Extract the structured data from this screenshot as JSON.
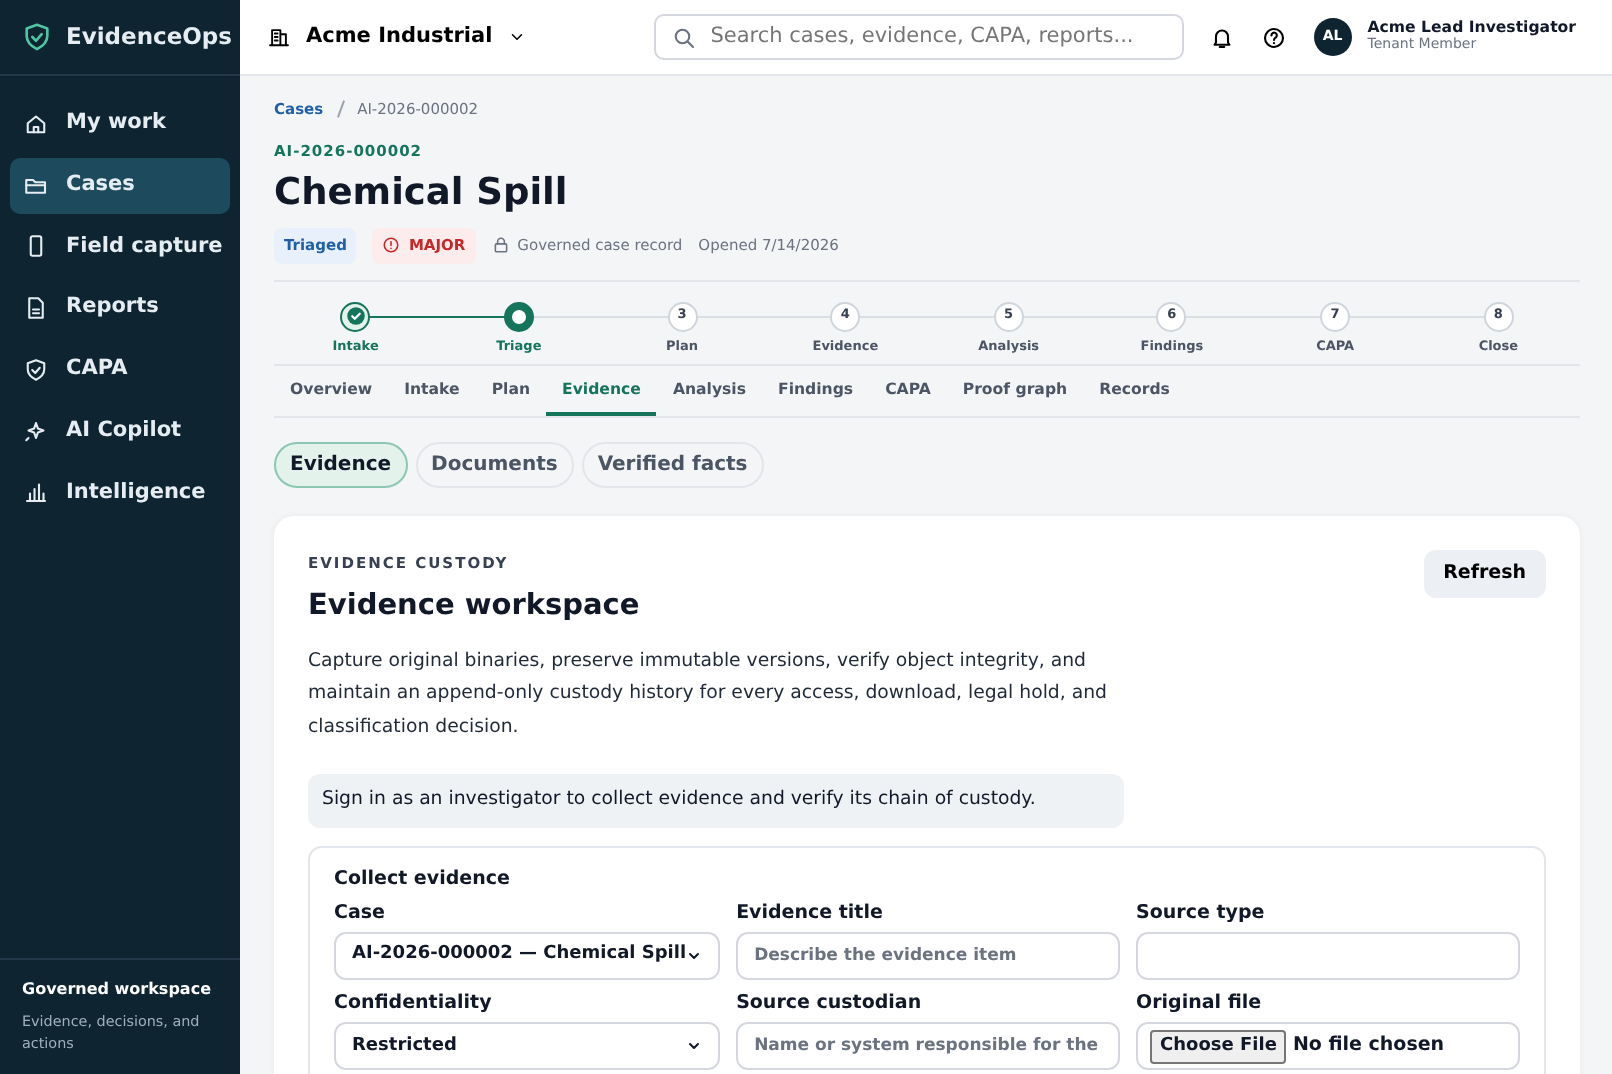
{
  "sidebar": {
    "brand": "EvidenceOps",
    "items": [
      {
        "label": "My work",
        "selected": false
      },
      {
        "label": "Cases",
        "selected": true
      },
      {
        "label": "Field capture",
        "selected": false
      },
      {
        "label": "Reports",
        "selected": false
      },
      {
        "label": "CAPA",
        "selected": false
      },
      {
        "label": "AI Copilot",
        "selected": false
      },
      {
        "label": "Intelligence",
        "selected": false
      }
    ],
    "footer": {
      "title": "Governed workspace",
      "text": "Evidence, decisions, and actions"
    }
  },
  "topbar": {
    "tenant": "Acme Industrial",
    "search": {
      "placeholder": "Search cases, evidence, CAPA, reports..."
    },
    "user": {
      "initials": "AL",
      "name": "Acme Lead Investigator",
      "role": "Tenant Member"
    }
  },
  "breadcrumb": [
    "Cases",
    "AI-2026-000002"
  ],
  "case": {
    "id": "AI-2026-000002",
    "title": "Chemical Spill",
    "status": "Triaged",
    "severity": "MAJOR",
    "record": "Governed case record",
    "opened": "Opened 7/14/2026"
  },
  "steps": [
    {
      "label": "Intake",
      "kind": "done"
    },
    {
      "label": "Triage",
      "kind": "current"
    },
    {
      "label": "Plan",
      "kind": "upcoming",
      "number": "3"
    },
    {
      "label": "Evidence",
      "kind": "upcoming",
      "number": "4"
    },
    {
      "label": "Analysis",
      "kind": "upcoming",
      "number": "5"
    },
    {
      "label": "Findings",
      "kind": "upcoming",
      "number": "6"
    },
    {
      "label": "CAPA",
      "kind": "upcoming",
      "number": "7"
    },
    {
      "label": "Close",
      "kind": "upcoming",
      "number": "8"
    }
  ],
  "tabs": [
    {
      "label": "Overview",
      "selected": false
    },
    {
      "label": "Intake",
      "selected": false
    },
    {
      "label": "Plan",
      "selected": false
    },
    {
      "label": "Evidence",
      "selected": true
    },
    {
      "label": "Analysis",
      "selected": false
    },
    {
      "label": "Findings",
      "selected": false
    },
    {
      "label": "CAPA",
      "selected": false
    },
    {
      "label": "Proof graph",
      "selected": false
    },
    {
      "label": "Records",
      "selected": false
    }
  ],
  "subtabs": [
    {
      "label": "Evidence",
      "selected": true
    },
    {
      "label": "Documents",
      "selected": false
    },
    {
      "label": "Verified facts",
      "selected": false
    }
  ],
  "panel": {
    "eyebrow": "EVIDENCE CUSTODY",
    "title": "Evidence workspace",
    "refresh": "Refresh",
    "description": "Capture original binaries, preserve immutable versions, verify object integrity, and maintain an append-only custody history for every access, download, legal hold, and classification decision.",
    "notice": "Sign in as an investigator to collect evidence and verify its chain of custody.",
    "form": {
      "title": "Collect evidence",
      "fields": [
        {
          "label": "Case",
          "kind": "select",
          "value": "AI-2026-000002 — Chemical Spill"
        },
        {
          "label": "Evidence title",
          "kind": "text",
          "placeholder": "Describe the evidence item"
        },
        {
          "label": "Source type",
          "kind": "text"
        },
        {
          "label": "Confidentiality",
          "kind": "select",
          "value": "Restricted"
        },
        {
          "label": "Source custodian",
          "kind": "text",
          "placeholder": "Name or system responsible for the"
        },
        {
          "label": "Original file",
          "kind": "file",
          "button": "Choose File",
          "value": "No file chosen"
        }
      ]
    }
  }
}
